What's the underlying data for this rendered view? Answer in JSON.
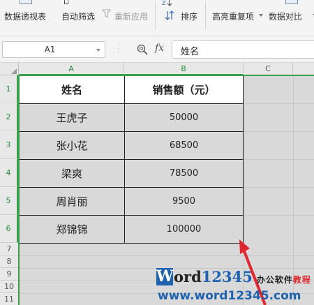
{
  "ribbon": {
    "pivot_table": "数据透视表",
    "auto_filter": "自动筛选",
    "reapply": "重新应用",
    "sort": "排序",
    "highlight_duplicates": "高亮重复项",
    "data_compare": "数据对比"
  },
  "formula_bar": {
    "name_box": "A1",
    "fx": "fx",
    "content": "姓名"
  },
  "columns": [
    "A",
    "B",
    "C"
  ],
  "rows": [
    "1",
    "2",
    "3",
    "4",
    "5",
    "6",
    "7",
    "8",
    "9",
    "10",
    "11"
  ],
  "table": {
    "headers": [
      "姓名",
      "销售额（元）"
    ],
    "rows": [
      [
        "王虎子",
        "50000"
      ],
      [
        "张小花",
        "68500"
      ],
      [
        "梁爽",
        "78500"
      ],
      [
        "周肖丽",
        "9500"
      ],
      [
        "郑锦锦",
        "100000"
      ]
    ]
  },
  "watermark": {
    "logo_letter": "W",
    "brand_text": "ord",
    "brand_digits": "12345",
    "tagline_a": "办公软件",
    "tagline_b": "教程",
    "url": "www.word12345.com"
  },
  "colors": {
    "selection_green": "#3aa04a",
    "arrow_red": "#e0262e",
    "brand_blue": "#1e62b0"
  }
}
